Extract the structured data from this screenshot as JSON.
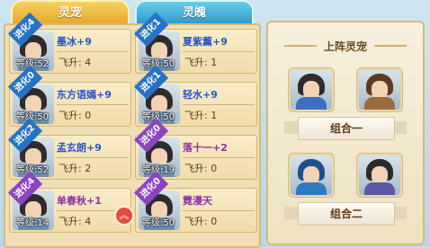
{
  "tabs": {
    "pets": "灵宠",
    "spirits": "灵魄"
  },
  "pets": [
    {
      "evolution": "进化4",
      "ribbon_color": "#2673c5",
      "name": "墨冰+9",
      "name_color": "#2b55c9",
      "level_label": "等级:",
      "level": "52",
      "fly_label": "飞升:",
      "fly": "4"
    },
    {
      "evolution": "进化1",
      "ribbon_color": "#2673c5",
      "name": "夏紫薰+9",
      "name_color": "#2b55c9",
      "level_label": "等级:",
      "level": "50",
      "fly_label": "飞升:",
      "fly": "1"
    },
    {
      "evolution": "进化0",
      "ribbon_color": "#2673c5",
      "name": "东方语嫣+9",
      "name_color": "#2b55c9",
      "level_label": "等级:",
      "level": "50",
      "fly_label": "飞升:",
      "fly": "0"
    },
    {
      "evolution": "进化1",
      "ribbon_color": "#2673c5",
      "name": "轻水+9",
      "name_color": "#2b55c9",
      "level_label": "等级:",
      "level": "50",
      "fly_label": "飞升:",
      "fly": "1"
    },
    {
      "evolution": "进化2",
      "ribbon_color": "#2673c5",
      "name": "孟玄朗+9",
      "name_color": "#2b55c9",
      "level_label": "等级:",
      "level": "52",
      "fly_label": "飞升:",
      "fly": "2"
    },
    {
      "evolution": "进化0",
      "ribbon_color": "#8b45c1",
      "name": "落十一+2",
      "name_color": "#8d2fa8",
      "level_label": "等级:",
      "level": "19",
      "fly_label": "飞升:",
      "fly": "0"
    },
    {
      "evolution": "进化4",
      "ribbon_color": "#8b45c1",
      "name": "单春秋+1",
      "name_color": "#8d2fa8",
      "level_label": "等级:",
      "level": "14",
      "fly_label": "飞升:",
      "fly": "4"
    },
    {
      "evolution": "进化0",
      "ribbon_color": "#8b45c1",
      "name": "霓漫天",
      "name_color": "#8d2fa8",
      "level_label": "等级:",
      "level": "50",
      "fly_label": "飞升:",
      "fly": "0"
    }
  ],
  "panel": {
    "title": "上阵灵宠",
    "group1": "组合一",
    "group2": "组合二"
  },
  "icons": {
    "scroll_up": "double-up-arrow"
  }
}
